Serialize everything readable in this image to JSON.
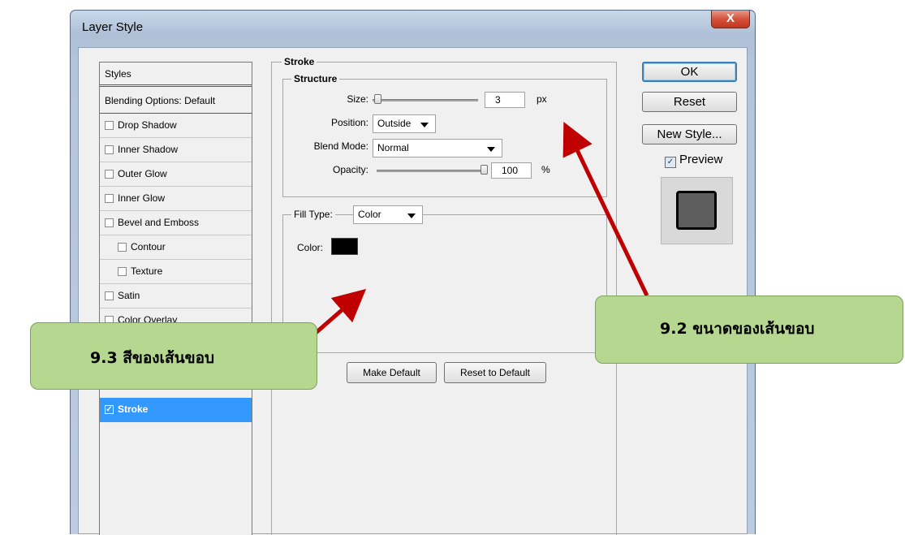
{
  "window": {
    "title": "Layer Style",
    "close_glyph": "X"
  },
  "styles_list": {
    "header": "Styles",
    "blending": "Blending Options: Default",
    "items": [
      {
        "label": "Drop Shadow",
        "checked": false
      },
      {
        "label": "Inner Shadow",
        "checked": false
      },
      {
        "label": "Outer Glow",
        "checked": false
      },
      {
        "label": "Inner Glow",
        "checked": false
      },
      {
        "label": "Bevel and Emboss",
        "checked": false
      },
      {
        "label": "Contour",
        "checked": false
      },
      {
        "label": "Texture",
        "checked": false
      },
      {
        "label": "Satin",
        "checked": false
      },
      {
        "label": "Color Overlay",
        "checked": false
      },
      {
        "label": "Stroke",
        "checked": true,
        "selected": true
      }
    ],
    "check_glyph": "✓"
  },
  "stroke": {
    "title": "Stroke",
    "structure": {
      "title": "Structure",
      "size_label": "Size:",
      "size_value": "3",
      "size_unit": "px",
      "position_label": "Position:",
      "position_value": "Outside",
      "blend_label": "Blend Mode:",
      "blend_value": "Normal",
      "opacity_label": "Opacity:",
      "opacity_value": "100",
      "opacity_unit": "%"
    },
    "fill": {
      "type_label": "Fill Type:",
      "type_value": "Color",
      "color_label": "Color:",
      "color_value": "#000000"
    },
    "make_default": "Make Default",
    "reset_default": "Reset to Default"
  },
  "right": {
    "ok": "OK",
    "reset": "Reset",
    "new_style": "New Style...",
    "preview_label": "Preview",
    "preview_checked": true
  },
  "callouts": {
    "color": "9.3 สีของเส้นขอบ",
    "size": "9.2 ขนาดของเส้นขอบ"
  },
  "colors": {
    "selection": "#3399ff",
    "callout_fill": "#b5d78f",
    "arrow": "#c00000"
  }
}
